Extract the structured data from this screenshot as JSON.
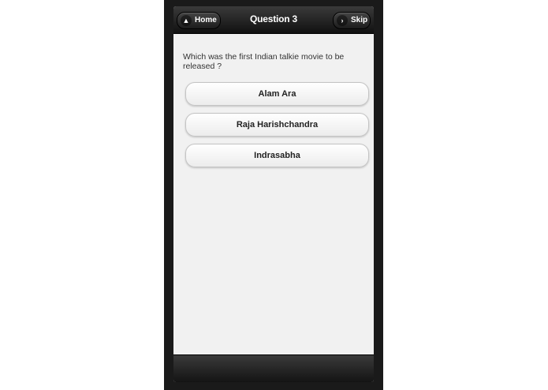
{
  "header": {
    "title": "Question 3",
    "home_label": "Home",
    "skip_label": "Skip"
  },
  "question": {
    "text": "Which was the first Indian talkie movie to be released ?"
  },
  "answers": [
    {
      "label": "Alam Ara"
    },
    {
      "label": "Raja Harishchandra"
    },
    {
      "label": "Indrasabha"
    }
  ],
  "icons": {
    "home": "home-icon",
    "skip": "arrow-right-icon"
  },
  "colors": {
    "header_bg": "#1a1a1a",
    "content_bg": "#f1f1f1",
    "button_text": "#222222"
  }
}
